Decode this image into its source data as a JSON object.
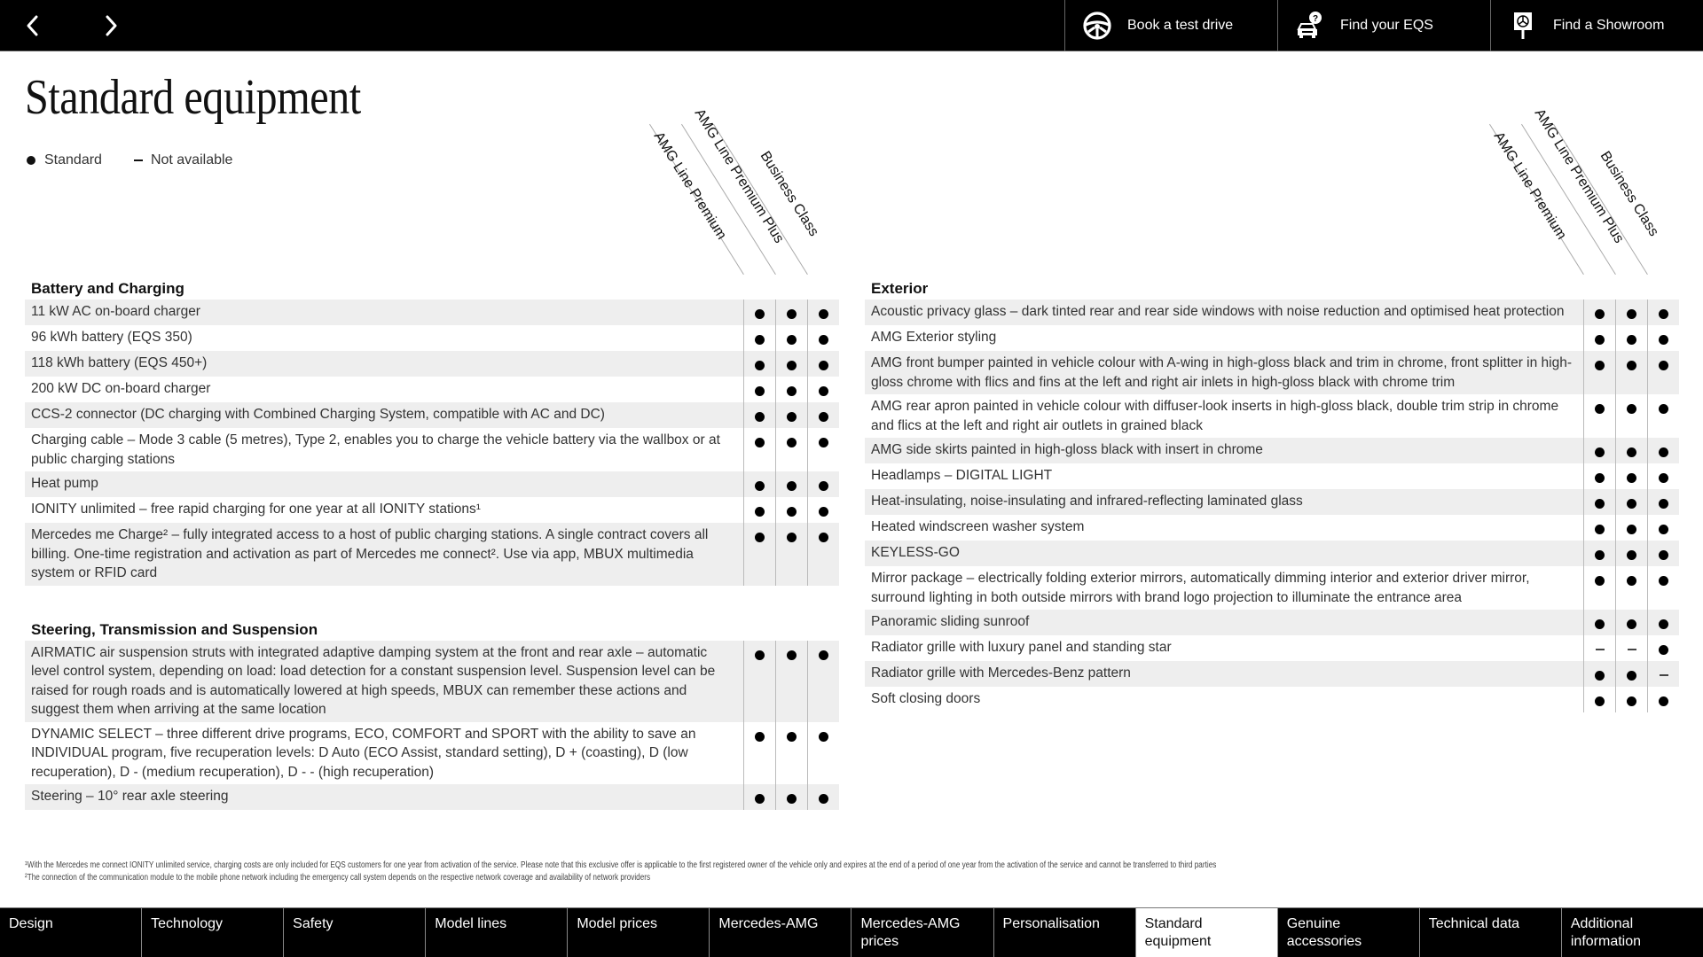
{
  "topbar": {
    "prev_icon": "chevron-left-icon",
    "next_icon": "chevron-right-icon",
    "actions": [
      {
        "label": "Book a test drive",
        "icon": "steering-wheel-icon"
      },
      {
        "label": "Find your EQS",
        "icon": "car-question-icon"
      },
      {
        "label": "Find a Showroom",
        "icon": "showroom-sign-icon"
      }
    ]
  },
  "page": {
    "title": "Standard equipment",
    "legend": {
      "standard": "Standard",
      "not_available": "Not available"
    }
  },
  "columns": [
    "AMG Line Premium",
    "AMG Line Premium Plus",
    "Business Class"
  ],
  "left": {
    "sections": [
      {
        "title": "Battery and Charging",
        "rows": [
          {
            "label": "11 kW AC on-board charger",
            "marks": [
              "standard",
              "standard",
              "standard"
            ]
          },
          {
            "label": "96 kWh battery (EQS 350)",
            "marks": [
              "standard",
              "standard",
              "standard"
            ]
          },
          {
            "label": "118 kWh battery (EQS 450+)",
            "marks": [
              "standard",
              "standard",
              "standard"
            ]
          },
          {
            "label": "200 kW DC on-board charger",
            "marks": [
              "standard",
              "standard",
              "standard"
            ]
          },
          {
            "label": "CCS-2 connector (DC charging with Combined Charging System, compatible with AC and DC)",
            "marks": [
              "standard",
              "standard",
              "standard"
            ]
          },
          {
            "label": "Charging cable – Mode 3 cable (5 metres), Type 2, enables you to charge the vehicle battery via the wallbox or at public charging stations",
            "marks": [
              "standard",
              "standard",
              "standard"
            ]
          },
          {
            "label": "Heat pump",
            "marks": [
              "standard",
              "standard",
              "standard"
            ]
          },
          {
            "label": "IONITY unlimited – free rapid charging for one year at all IONITY stations¹",
            "marks": [
              "standard",
              "standard",
              "standard"
            ]
          },
          {
            "label": "Mercedes me Charge² – fully integrated access to a host of public charging stations. A single contract covers all billing. One-time registration and activation as part of Mercedes me connect². Use via app, MBUX multimedia system or RFID card",
            "marks": [
              "standard",
              "standard",
              "standard"
            ]
          }
        ]
      },
      {
        "title": "Steering, Transmission and Suspension",
        "rows": [
          {
            "label": "AIRMATIC air suspension struts with integrated adaptive damping system at the front and rear axle – automatic level control system, depending on load: load detection for a constant suspension level. Suspension level can be raised for rough roads and is automatically lowered at high speeds, MBUX can remember these actions and suggest them when arriving at the same location",
            "marks": [
              "standard",
              "standard",
              "standard"
            ]
          },
          {
            "label": "DYNAMIC SELECT – three different drive programs, ECO, COMFORT and SPORT with the ability to save an INDIVIDUAL program, five recuperation levels: D Auto (ECO Assist, standard setting), D + (coasting), D (low recuperation), D - (medium recuperation), D - - (high recuperation)",
            "marks": [
              "standard",
              "standard",
              "standard"
            ]
          },
          {
            "label": "Steering – 10° rear axle steering",
            "marks": [
              "standard",
              "standard",
              "standard"
            ]
          }
        ]
      }
    ]
  },
  "right": {
    "sections": [
      {
        "title": "Exterior",
        "rows": [
          {
            "label": "Acoustic privacy glass – dark tinted rear and rear side windows with noise reduction and optimised heat protection",
            "marks": [
              "standard",
              "standard",
              "standard"
            ]
          },
          {
            "label": "AMG Exterior styling",
            "marks": [
              "standard",
              "standard",
              "standard"
            ]
          },
          {
            "label": "AMG front bumper painted in vehicle colour with A-wing in high-gloss black and trim in chrome, front splitter in high-gloss chrome with flics and fins at the left and right air inlets in high-gloss black with chrome trim",
            "marks": [
              "standard",
              "standard",
              "standard"
            ]
          },
          {
            "label": "AMG rear apron painted in vehicle colour with diffuser-look inserts in high-gloss black, double trim strip in chrome and flics at the left and right air outlets in grained black",
            "marks": [
              "standard",
              "standard",
              "standard"
            ]
          },
          {
            "label": "AMG side skirts painted in high-gloss black with insert in chrome",
            "marks": [
              "standard",
              "standard",
              "standard"
            ]
          },
          {
            "label": "Headlamps – DIGITAL LIGHT",
            "marks": [
              "standard",
              "standard",
              "standard"
            ]
          },
          {
            "label": "Heat-insulating, noise-insulating and infrared-reflecting laminated glass",
            "marks": [
              "standard",
              "standard",
              "standard"
            ]
          },
          {
            "label": "Heated windscreen washer system",
            "marks": [
              "standard",
              "standard",
              "standard"
            ]
          },
          {
            "label": "KEYLESS-GO",
            "marks": [
              "standard",
              "standard",
              "standard"
            ]
          },
          {
            "label": "Mirror package – electrically folding exterior mirrors, automatically dimming interior and exterior driver mirror, surround lighting in both outside mirrors with brand logo projection to illuminate the entrance area",
            "marks": [
              "standard",
              "standard",
              "standard"
            ]
          },
          {
            "label": "Panoramic sliding sunroof",
            "marks": [
              "standard",
              "standard",
              "standard"
            ]
          },
          {
            "label": "Radiator grille with luxury panel and standing star",
            "marks": [
              "not_available",
              "not_available",
              "standard"
            ]
          },
          {
            "label": "Radiator grille with Mercedes-Benz pattern",
            "marks": [
              "standard",
              "standard",
              "not_available"
            ]
          },
          {
            "label": "Soft closing doors",
            "marks": [
              "standard",
              "standard",
              "standard"
            ]
          }
        ]
      }
    ]
  },
  "footnotes": [
    "¹With the Mercedes me connect IONITY unlimited service, charging costs are only included for EQS customers for one year from activation of the service. Please note that this exclusive offer is applicable to the first registered owner of the vehicle only and expires at the end of a period of one year from the activation of the service and cannot be transferred to third parties",
    "²The connection of the communication module to the mobile phone network including the emergency call system depends on the respective network coverage and availability of network providers"
  ],
  "bottom_nav": {
    "active_index": 8,
    "items": [
      "Design",
      "Technology",
      "Safety",
      "Model lines",
      "Model prices",
      "Mercedes-AMG",
      "Mercedes-AMG prices",
      "Personalisation",
      "Standard equipment",
      "Genuine accessories",
      "Technical data",
      "Additional information"
    ]
  }
}
